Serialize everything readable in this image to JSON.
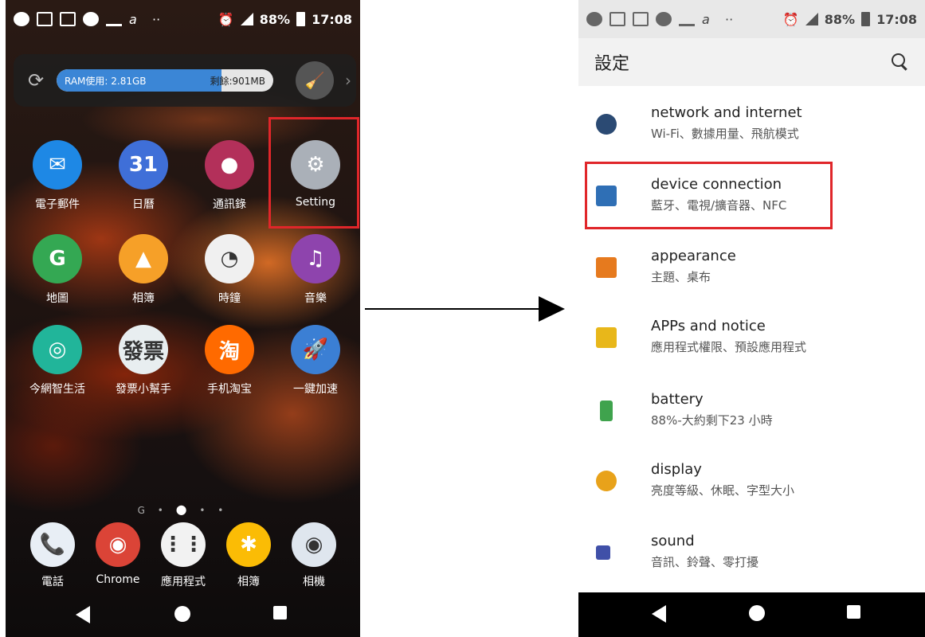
{
  "home_screen": {
    "status_bar": {
      "battery": "88%",
      "time": "17:08"
    },
    "ram_widget": {
      "used_label": "RAM使用: 2.81GB",
      "free_label": "剩餘:901MB",
      "used_fraction": 0.76
    },
    "apps": [
      {
        "label": "電子郵件",
        "icon": "mail-icon",
        "color": "#1e88e5",
        "glyph": "✉"
      },
      {
        "label": "日曆",
        "icon": "calendar-icon",
        "color": "#3f6fd8",
        "glyph": "31"
      },
      {
        "label": "通訊錄",
        "icon": "contacts-icon",
        "color": "#b3305a",
        "glyph": "●"
      },
      {
        "label": "Setting",
        "icon": "gear-icon",
        "color": "#aab0b8",
        "glyph": "⚙"
      },
      {
        "label": "地圖",
        "icon": "maps-icon",
        "color": "#34a853",
        "glyph": "G"
      },
      {
        "label": "相簿",
        "icon": "album-icon",
        "color": "#f6a028",
        "glyph": "▲"
      },
      {
        "label": "時鐘",
        "icon": "clock-icon",
        "color": "#f0f0f0",
        "glyph": "◔"
      },
      {
        "label": "音樂",
        "icon": "music-icon",
        "color": "#8e44ad",
        "glyph": "♫"
      },
      {
        "label": "今網智生活",
        "icon": "smartlife-icon",
        "color": "#21b59a",
        "glyph": "◎"
      },
      {
        "label": "發票小幫手",
        "icon": "invoice-icon",
        "color": "#e8eef0",
        "glyph": "發票"
      },
      {
        "label": "手机淘宝",
        "icon": "taobao-icon",
        "color": "#ff6a00",
        "glyph": "淘"
      },
      {
        "label": "一鍵加速",
        "icon": "booster-icon",
        "color": "#3b7fd4",
        "glyph": "🚀"
      }
    ],
    "dock": [
      {
        "label": "電話",
        "icon": "phone-icon",
        "color": "#e8eef5",
        "glyph": "📞"
      },
      {
        "label": "Chrome",
        "icon": "chrome-icon",
        "color": "#db4437",
        "glyph": "◉"
      },
      {
        "label": "應用程式",
        "icon": "app-drawer-icon",
        "color": "#f2f2f2",
        "glyph": "⋮⋮"
      },
      {
        "label": "相簿",
        "icon": "photos-icon",
        "color": "#fbbc05",
        "glyph": "✱"
      },
      {
        "label": "相機",
        "icon": "camera-icon",
        "color": "#dfe6ee",
        "glyph": "◉"
      }
    ]
  },
  "settings_screen": {
    "status_bar": {
      "battery": "88%",
      "time": "17:08"
    },
    "title": "設定",
    "items": [
      {
        "title": "network and internet",
        "subtitle": "Wi-Fi、數據用量、飛航模式",
        "icon": "wifi-icon",
        "color": "#2b4a73"
      },
      {
        "title": "device connection",
        "subtitle": "藍牙、電視/擴音器、NFC",
        "icon": "device-connection-icon",
        "color": "#2f6fb5"
      },
      {
        "title": "appearance",
        "subtitle": "主題、桌布",
        "icon": "appearance-icon",
        "color": "#e67a1e"
      },
      {
        "title": "APPs and notice",
        "subtitle": "應用程式權限、預設應用程式",
        "icon": "apps-icon",
        "color": "#e8b71a"
      },
      {
        "title": "battery",
        "subtitle": "88%-大約剩下23 小時",
        "icon": "battery-icon",
        "color": "#3fa34d"
      },
      {
        "title": "display",
        "subtitle": "亮度等級、休眠、字型大小",
        "icon": "display-icon",
        "color": "#e8a21a"
      },
      {
        "title": "sound",
        "subtitle": "音訊、鈴聲、零打擾",
        "icon": "sound-icon",
        "color": "#4050a8"
      }
    ]
  }
}
